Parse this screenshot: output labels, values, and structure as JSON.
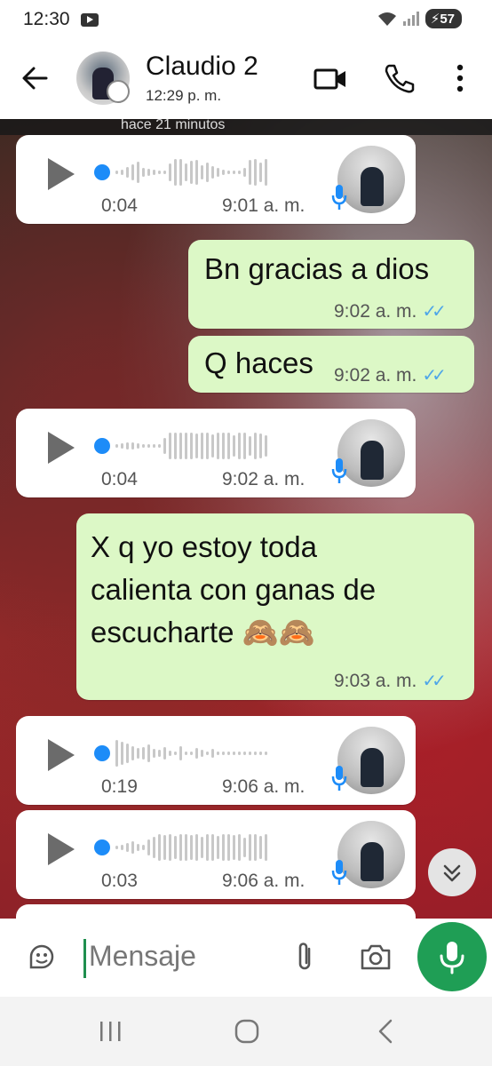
{
  "status_bar": {
    "time": "12:30",
    "battery": "57"
  },
  "header": {
    "contact_name": "Claudio 2",
    "last_seen": "12:29 p. m."
  },
  "top_strip": {
    "text": "hace 21 minutos"
  },
  "messages": [
    {
      "type": "voice",
      "direction": "in",
      "duration": "0:04",
      "time": "9:01 a. m."
    },
    {
      "type": "text",
      "direction": "out",
      "text": "Bn gracias a dios",
      "time": "9:02 a. m.",
      "status": "read"
    },
    {
      "type": "text",
      "direction": "out",
      "text": "Q haces",
      "time": "9:02 a. m.",
      "status": "read"
    },
    {
      "type": "voice",
      "direction": "in",
      "duration": "0:04",
      "time": "9:02 a. m."
    },
    {
      "type": "text",
      "direction": "out",
      "lines": [
        "X q yo estoy toda",
        "calienta con ganas de",
        "escucharte 🙈🙈"
      ],
      "time": "9:03 a. m.",
      "status": "read"
    },
    {
      "type": "voice",
      "direction": "in",
      "duration": "0:19",
      "time": "9:06 a. m."
    },
    {
      "type": "voice",
      "direction": "in",
      "duration": "0:03",
      "time": "9:06 a. m."
    }
  ],
  "input": {
    "placeholder": "Mensaje"
  },
  "colors": {
    "outgoing_bubble": "#dcf8c6",
    "incoming_bubble": "#ffffff",
    "accent_green": "#1f9e55",
    "read_ticks": "#4fa6e8",
    "voice_dot": "#1d8cf8"
  }
}
